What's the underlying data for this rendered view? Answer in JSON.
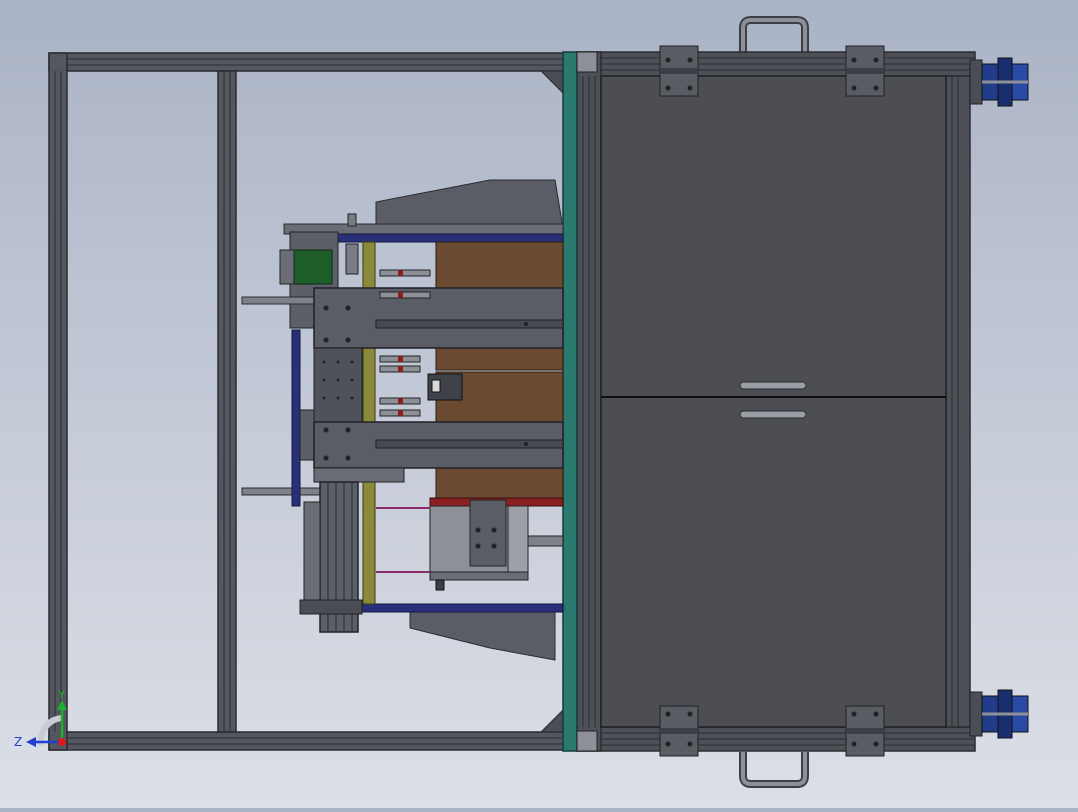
{
  "viewport": {
    "background_top": "#aab3c6",
    "background_bottom": "#dcdfe6"
  },
  "triad": {
    "y_label": "Y",
    "z_label": "Z",
    "y_color": "#1fae2f",
    "z_color": "#1f3fd6",
    "x_color": "#d81c1c"
  },
  "colors": {
    "frame_dark": "#3a3d44",
    "frame_mid": "#5b5f68",
    "panel": "#4c4e54",
    "panel_edge": "#2b2d31",
    "teal": "#2a7a70",
    "brown": "#6b4a32",
    "green_motor": "#1e5e2a",
    "navy": "#2a2f7a",
    "olive": "#8a8a3a",
    "blue_caster": "#223c8c",
    "red_accent": "#8c2020",
    "handle": "#8d9096"
  }
}
